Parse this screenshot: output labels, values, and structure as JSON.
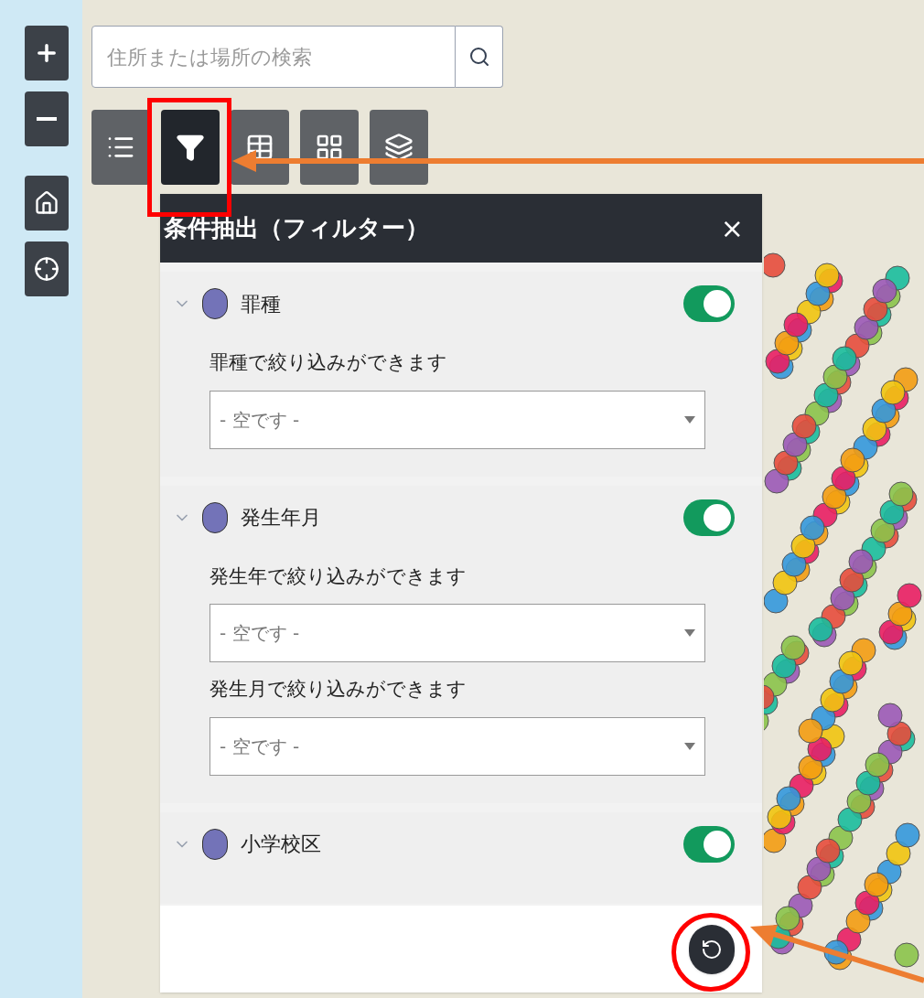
{
  "search": {
    "placeholder": "住所または場所の検索"
  },
  "toolbar": [
    {
      "kind": "legend",
      "selected": false
    },
    {
      "kind": "filter",
      "selected": true
    },
    {
      "kind": "table",
      "selected": false
    },
    {
      "kind": "grid",
      "selected": false
    },
    {
      "kind": "layers",
      "selected": false
    }
  ],
  "panel": {
    "title": "条件抽出（フィルター）",
    "close": "×",
    "filters": [
      {
        "name": "罪種",
        "on": true,
        "fields": [
          {
            "label": "罪種で絞り込みができます",
            "value": "- 空です -"
          }
        ]
      },
      {
        "name": "発生年月",
        "on": true,
        "fields": [
          {
            "label": "発生年で絞り込みができます",
            "value": "- 空です -"
          },
          {
            "label": "発生月で絞り込みができます",
            "value": "- 空です -"
          }
        ]
      },
      {
        "name": "小学校区",
        "on": true
      }
    ]
  }
}
